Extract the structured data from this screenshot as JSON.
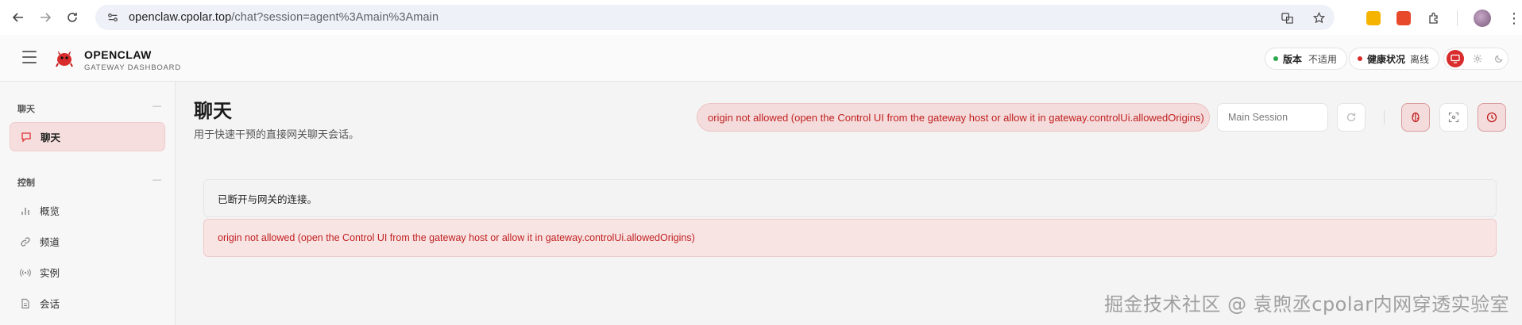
{
  "browser": {
    "url_host": "openclaw.cpolar.top",
    "url_path": "/chat?session=agent%3Amain%3Amain"
  },
  "header": {
    "brand_title": "OPENCLAW",
    "brand_subtitle": "GATEWAY DASHBOARD",
    "version_label": "版本",
    "version_value": "不适用",
    "health_label": "健康状况",
    "health_value": "离线",
    "status_colors": {
      "version_dot": "#2aa84a",
      "health_dot": "#d92c2c"
    }
  },
  "sidebar": {
    "sections": [
      {
        "title": "聊天",
        "collapse": "—",
        "items": [
          {
            "label": "聊天",
            "icon": "chat-bubble-icon",
            "active": true
          }
        ]
      },
      {
        "title": "控制",
        "collapse": "—",
        "items": [
          {
            "label": "概览",
            "icon": "bar-chart-icon"
          },
          {
            "label": "频道",
            "icon": "link-icon"
          },
          {
            "label": "实例",
            "icon": "broadcast-icon"
          },
          {
            "label": "会话",
            "icon": "document-icon"
          }
        ]
      }
    ]
  },
  "main": {
    "title": "聊天",
    "subtitle": "用于快速干预的直接网关聊天会话。",
    "error_pill": "origin not allowed (open the Control UI from the gateway host or allow it in gateway.controlUi.allowedOrigins)",
    "session_select": "Main Session",
    "notice": "已断开与网关的连接。",
    "error_message": "origin not allowed (open the Control UI from the gateway host or allow it in gateway.controlUi.allowedOrigins)"
  },
  "watermark": "掘金技术社区 @ 袁煦丞cpolar内网穿透实验室",
  "colors": {
    "accent": "#d92c2c",
    "error_text": "#c01f1f",
    "error_bg": "#f5dcdc"
  }
}
